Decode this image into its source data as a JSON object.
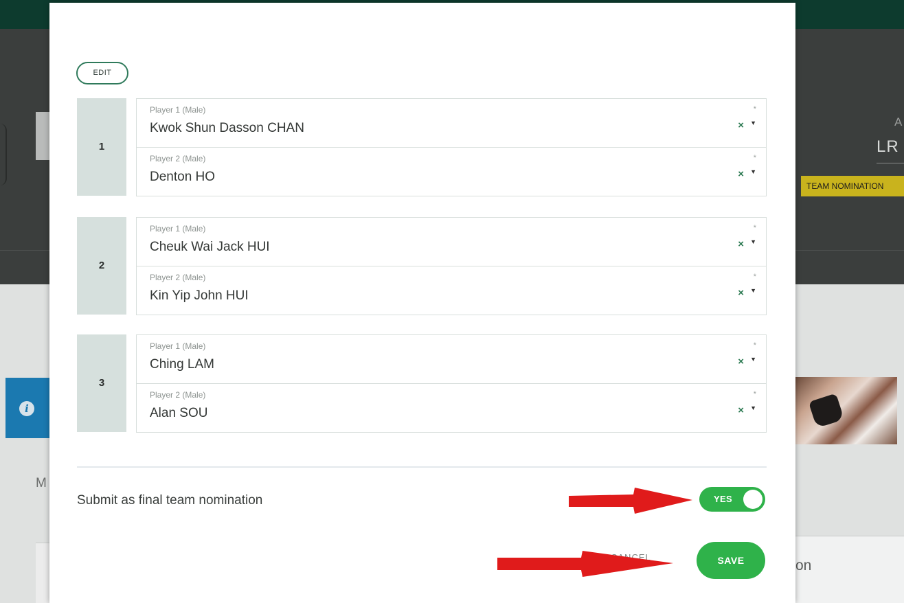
{
  "background": {
    "right_header_initial": "A",
    "right_header_code": "LR",
    "right_badge": "TEAM NOMINATION",
    "left_letter": "M",
    "right_text": "on"
  },
  "modal": {
    "edit_label": "EDIT",
    "pairs": [
      {
        "number": "1",
        "players": [
          {
            "label": "Player 1 (Male)",
            "value": "Kwok Shun Dasson CHAN"
          },
          {
            "label": "Player 2 (Male)",
            "value": "Denton HO"
          }
        ]
      },
      {
        "number": "2",
        "players": [
          {
            "label": "Player 1 (Male)",
            "value": "Cheuk Wai Jack HUI"
          },
          {
            "label": "Player 2 (Male)",
            "value": "Kin Yip John HUI"
          }
        ]
      },
      {
        "number": "3",
        "players": [
          {
            "label": "Player 1 (Male)",
            "value": "Ching LAM"
          },
          {
            "label": "Player 2 (Male)",
            "value": "Alan SOU"
          }
        ]
      }
    ],
    "required_marker": "*",
    "clear_icon_glyph": "×",
    "caret_icon_glyph": "▼",
    "final_nomination_label": "Submit as final team nomination",
    "final_toggle": {
      "state_label": "YES",
      "on": true
    },
    "cancel_label": "CANCEL",
    "save_label": "SAVE"
  },
  "colors": {
    "primary_green": "#2fb24a",
    "dark_green": "#0d3b2e",
    "annotation_red": "#e01b1b",
    "pair_badge_bg": "#d6e0dd"
  },
  "icons": [
    "info-icon",
    "clear-icon",
    "dropdown-caret-icon",
    "toggle-knob",
    "red-arrow-annotation"
  ]
}
